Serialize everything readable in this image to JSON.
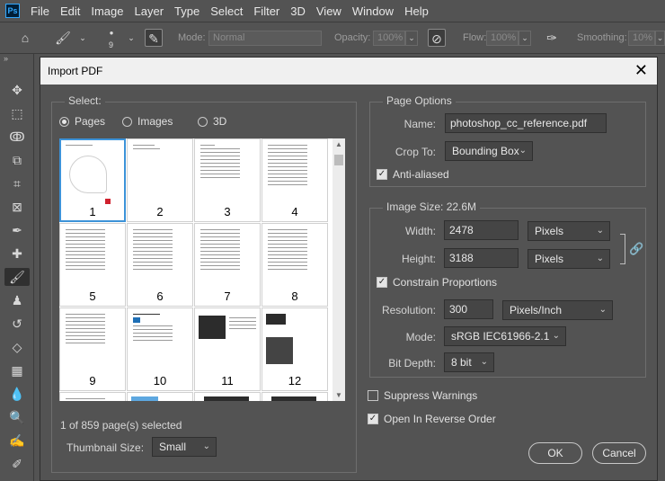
{
  "menubar": {
    "logo": "Ps",
    "items": [
      "File",
      "Edit",
      "Image",
      "Layer",
      "Type",
      "Select",
      "Filter",
      "3D",
      "View",
      "Window",
      "Help"
    ]
  },
  "optionsbar": {
    "brush_size": "9",
    "mode_label": "Mode:",
    "mode_value": "Normal",
    "opacity_label": "Opacity:",
    "opacity_value": "100%",
    "flow_label": "Flow:",
    "flow_value": "100%",
    "smoothing_label": "Smoothing:",
    "smoothing_value": "10%"
  },
  "toolbar": {
    "collapse": "»",
    "tools": [
      "move-icon",
      "marquee-icon",
      "lasso-icon",
      "quick-select-icon",
      "crop-icon",
      "frame-icon",
      "eyedropper-icon",
      "healing-icon",
      "brush-icon",
      "stamp-icon",
      "history-brush-icon",
      "eraser-icon",
      "gradient-icon",
      "blur-icon",
      "dodge-icon",
      "pen-icon",
      "pen-alt-icon"
    ]
  },
  "dialog": {
    "title": "Import PDF",
    "close": "✕",
    "select": {
      "title": "Select:",
      "radio_pages": "Pages",
      "radio_images": "Images",
      "radio_3d": "3D",
      "selected": "Pages",
      "thumbnails": [
        "1",
        "2",
        "3",
        "4",
        "5",
        "6",
        "7",
        "8",
        "9",
        "10",
        "11",
        "12"
      ],
      "status": "1 of 859 page(s) selected",
      "thumb_size_label": "Thumbnail Size:",
      "thumb_size_value": "Small"
    },
    "page_options": {
      "title": "Page Options",
      "name_label": "Name:",
      "name_value": "photoshop_cc_reference.pdf",
      "crop_label": "Crop To:",
      "crop_value": "Bounding Box",
      "anti_aliased": "Anti-aliased",
      "anti_aliased_checked": true
    },
    "image_size": {
      "title": "Image Size: 22.6M",
      "width_label": "Width:",
      "width_value": "2478",
      "width_unit": "Pixels",
      "height_label": "Height:",
      "height_value": "3188",
      "height_unit": "Pixels",
      "constrain": "Constrain Proportions",
      "constrain_checked": true,
      "resolution_label": "Resolution:",
      "resolution_value": "300",
      "resolution_unit": "Pixels/Inch",
      "mode_label": "Mode:",
      "mode_value": "sRGB IEC61966-2.1",
      "bitdepth_label": "Bit Depth:",
      "bitdepth_value": "8 bit"
    },
    "suppress_warnings": "Suppress Warnings",
    "suppress_checked": false,
    "reverse_order": "Open In Reverse Order",
    "reverse_checked": true,
    "ok": "OK",
    "cancel": "Cancel"
  }
}
